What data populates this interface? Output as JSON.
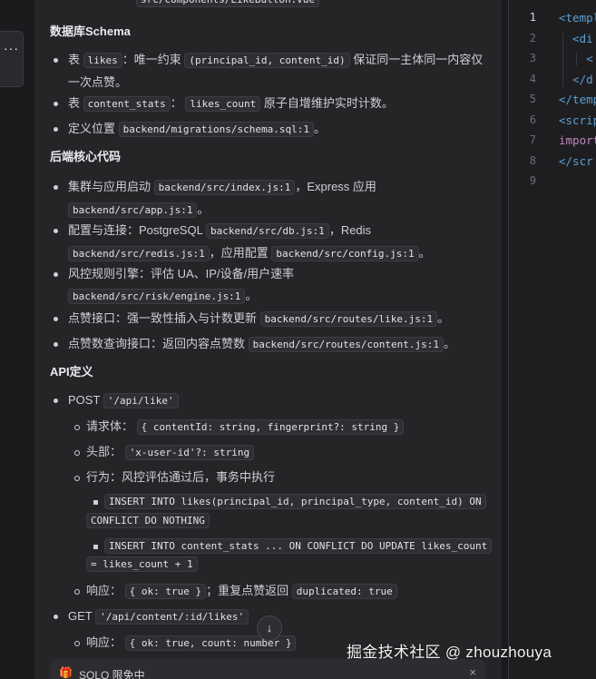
{
  "more_button_label": "···",
  "prev_path": "src/components/LikeButton.vue",
  "schema": {
    "title": "数据库Schema",
    "items": [
      {
        "pre": "表",
        "c1": "likes",
        "mid": "：唯一约束",
        "c2": "(principal_id, content_id)",
        "post": "保证同一主体同一内容仅",
        "line2": "一次点赞。"
      },
      {
        "pre": "表",
        "c1": "content_stats",
        "mid": "：",
        "c2": "likes_count",
        "post": "原子自增维护实时计数。"
      },
      {
        "pre": "定义位置",
        "c1": "backend/migrations/schema.sql:1",
        "post": "。"
      }
    ]
  },
  "backend": {
    "title": "后端核心代码",
    "items": [
      {
        "pre": "集群与应用启动",
        "c1": "backend/src/index.js:1",
        "mid": "，Express 应用",
        "c2": "backend/src/app.js:1",
        "post": "。"
      },
      {
        "pre": "配置与连接：PostgreSQL",
        "c1": "backend/src/db.js:1",
        "mid": "，Redis",
        "c2": "backend/src/redis.js:1",
        "mid2": "，应用配置",
        "c3": "backend/src/config.js:1",
        "post": "。"
      },
      {
        "pre": "风控规则引擎：评估 UA、IP/设备/用户速率",
        "c1": "backend/src/risk/engine.js:1",
        "post": "。"
      },
      {
        "pre": "点赞接口：强一致性插入与计数更新",
        "c1": "backend/src/routes/like.js:1",
        "post": "。"
      },
      {
        "pre": "点赞数查询接口：返回内容点赞数",
        "c1": "backend/src/routes/content.js:1",
        "post": "。"
      }
    ]
  },
  "api": {
    "title": "API定义",
    "post": {
      "method": "POST",
      "path": "'/api/like'",
      "body_label": "请求体：",
      "body_code": "{ contentId: string, fingerprint?: string }",
      "header_label": "头部：",
      "header_code": "'x-user-id'?: string",
      "behavior": "行为：风控评估通过后，事务中执行",
      "sql1a": "INSERT INTO likes(principal_id, principal_type, content_id) ON",
      "sql1b": "CONFLICT DO NOTHING",
      "sql2a": "INSERT INTO content_stats ... ON CONFLICT DO UPDATE likes_count",
      "sql2b": "= likes_count + 1",
      "resp_label": "响应：",
      "resp_code": "{ ok: true }",
      "resp_mid": "；重复点赞返回",
      "resp_code2": "duplicated: true"
    },
    "get": {
      "method": "GET",
      "path": "'/api/content/:id/likes'",
      "resp_label": "响应：",
      "resp_code": "{ ok: true, count: number }"
    }
  },
  "scroll_down_icon": "arrow-down-icon",
  "scroll_down_glyph": "↓",
  "solo": {
    "gift_glyph": "🎁",
    "label": "SOLO 限免中",
    "close_glyph": "×"
  },
  "editor": {
    "line_numbers": [
      "1",
      "2",
      "3",
      "4",
      "5",
      "6",
      "7",
      "8",
      "9"
    ],
    "lines": [
      {
        "t": "<templ",
        "c": "#5a9fd4"
      },
      {
        "t": "  <di",
        "c": "#5a9fd4"
      },
      {
        "t": "    <",
        "c": "#5a9fd4"
      },
      {
        "t": "  </d",
        "c": "#5a9fd4"
      },
      {
        "t": "</temp",
        "c": "#5a9fd4"
      },
      {
        "t": "<scrip",
        "c": "#5a9fd4"
      },
      {
        "t": "import",
        "c": "#c586c0"
      },
      {
        "t": "</scr",
        "c": "#5a9fd4"
      },
      {
        "t": "",
        "c": "#5a9fd4"
      }
    ]
  },
  "watermark": "掘金技术社区 @ zhouzhouya"
}
